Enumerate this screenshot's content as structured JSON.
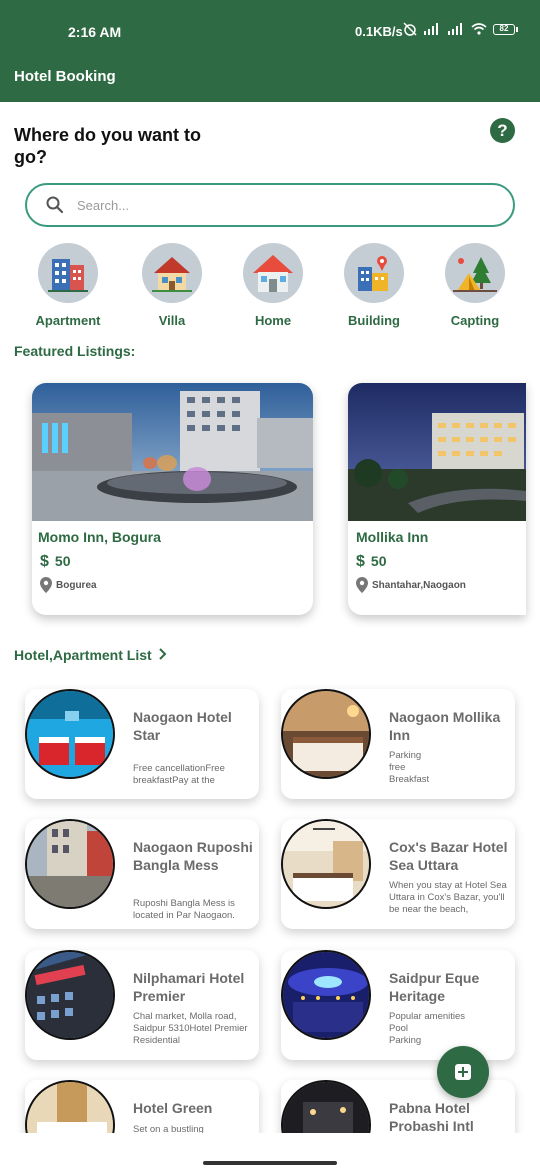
{
  "status_bar": {
    "time": "2:16 AM",
    "network_speed": "0.1KB/s",
    "battery": "82",
    "icons": [
      "alarm-off-icon",
      "signal-icon",
      "signal-icon",
      "wifi-icon",
      "battery-icon"
    ]
  },
  "app_bar": {
    "title": "Hotel Booking"
  },
  "header": {
    "title": "Where do you want to go?",
    "help_label": "?"
  },
  "search": {
    "placeholder": "Search..."
  },
  "categories": [
    {
      "label": "Apartment",
      "icon": "apartment-icon"
    },
    {
      "label": "Villa",
      "icon": "villa-icon"
    },
    {
      "label": "Home",
      "icon": "home-icon"
    },
    {
      "label": "Building",
      "icon": "building-icon"
    },
    {
      "label": "Capting",
      "icon": "camping-icon"
    }
  ],
  "featured": {
    "title": "Featured Listings:",
    "items": [
      {
        "name": "Momo Inn, Bogura",
        "currency": "$",
        "price": "50",
        "location": "Bogurea"
      },
      {
        "name": "Mollika Inn",
        "currency": "$",
        "price": "50",
        "location": "Shantahar,Naogaon"
      }
    ]
  },
  "list": {
    "title": "Hotel,Apartment List",
    "items": [
      {
        "name": "Naogaon Hotel Star",
        "desc": "Free cancellationFree breakfastPay at the"
      },
      {
        "name": "Naogaon Mollika Inn",
        "desc": "Parking\nfree\nBreakfast"
      },
      {
        "name": "Naogaon Ruposhi Bangla Mess",
        "desc": "Ruposhi Bangla Mess is located in Par Naogaon."
      },
      {
        "name": "Cox's Bazar Hotel Sea Uttara",
        "desc": "When you stay at Hotel Sea Uttara in Cox's Bazar, you'll be near the beach,"
      },
      {
        "name": "Nilphamari Hotel Premier",
        "desc": "Chal market, Molla road, Saidpur 5310Hotel Premier Residential"
      },
      {
        "name": "Saidpur Eque Heritage",
        "desc": "Popular amenities\nPool\nParking"
      },
      {
        "name": "Hotel Green",
        "desc": "Set on a bustling"
      },
      {
        "name": "Pabna Hotel Probashi Intl",
        "desc": ""
      }
    ]
  },
  "colors": {
    "primary": "#2e6a43",
    "search_border": "#3a9a80",
    "text_muted": "#6b6b6b"
  }
}
